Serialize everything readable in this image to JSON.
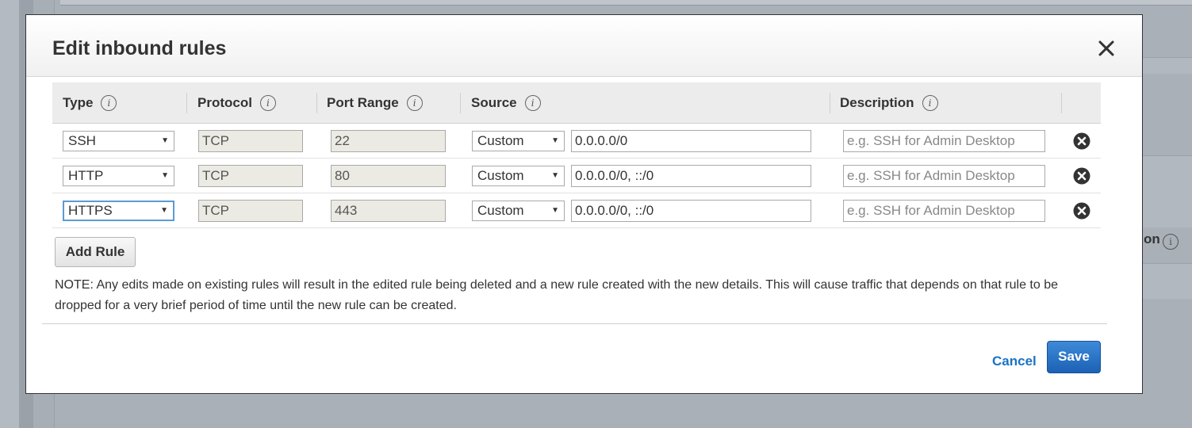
{
  "background": {
    "peek_text": "on"
  },
  "modal": {
    "title": "Edit inbound rules",
    "close_icon": "close-icon"
  },
  "table": {
    "headers": {
      "type": "Type",
      "protocol": "Protocol",
      "port_range": "Port Range",
      "source": "Source",
      "description": "Description"
    },
    "info_icon_glyph": "i",
    "rows": [
      {
        "type": "SSH",
        "protocol": "TCP",
        "port_range": "22",
        "source_type": "Custom",
        "source_value": "0.0.0.0/0",
        "description_placeholder": "e.g. SSH for Admin Desktop"
      },
      {
        "type": "HTTP",
        "protocol": "TCP",
        "port_range": "80",
        "source_type": "Custom",
        "source_value": "0.0.0.0/0, ::/0",
        "description_placeholder": "e.g. SSH for Admin Desktop"
      },
      {
        "type": "HTTPS",
        "protocol": "TCP",
        "port_range": "443",
        "source_type": "Custom",
        "source_value": "0.0.0.0/0, ::/0",
        "description_placeholder": "e.g. SSH for Admin Desktop"
      }
    ]
  },
  "add_rule_label": "Add Rule",
  "note": "NOTE: Any edits made on existing rules will result in the edited rule being deleted and a new rule created with the new details. This will cause traffic that depends on that rule to be dropped for a very brief period of time until the new rule can be created.",
  "footer": {
    "cancel_label": "Cancel",
    "save_label": "Save"
  },
  "colors": {
    "primary_button": "#1c61b5",
    "link": "#1a73c4",
    "focus_border": "#5b9bd5"
  }
}
